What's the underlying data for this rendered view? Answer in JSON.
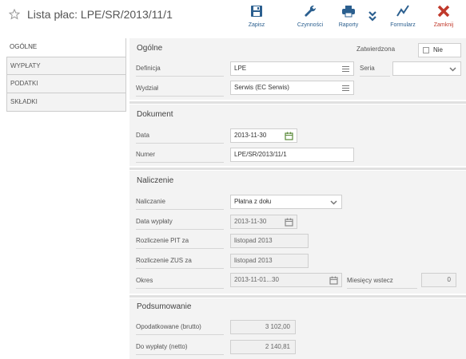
{
  "header": {
    "title": "Lista płac: LPE/SR/2013/11/1"
  },
  "toolbar": {
    "save": "Zapisz",
    "actions": "Czynności",
    "reports": "Raporty",
    "form": "Formularz",
    "close": "Zamknij"
  },
  "nav": {
    "items": [
      "OGÓLNE",
      "WYPŁATY",
      "PODATKI",
      "SKŁADKI"
    ]
  },
  "general": {
    "title": "Ogólne",
    "approved_label": "Zatwierdzona",
    "approved_value": "Nie",
    "definition_label": "Definicja",
    "definition_value": "LPE",
    "series_label": "Seria",
    "series_value": "",
    "department_label": "Wydział",
    "department_value": "Serwis (EC Serwis)"
  },
  "document": {
    "title": "Dokument",
    "date_label": "Data",
    "date_value": "2013-11-30",
    "number_label": "Numer",
    "number_value": "LPE/SR/2013/11/1"
  },
  "calc": {
    "title": "Naliczenie",
    "calc_label": "Naliczanie",
    "calc_value": "Płatna z dołu",
    "paydate_label": "Data wypłaty",
    "paydate_value": "2013-11-30",
    "pit_label": "Rozliczenie PIT za",
    "pit_value": "listopad 2013",
    "zus_label": "Rozliczenie ZUS za",
    "zus_value": "listopad 2013",
    "period_label": "Okres",
    "period_value": "2013-11-01...30",
    "months_back_label": "Miesięcy wstecz",
    "months_back_value": "0"
  },
  "summary": {
    "title": "Podsumowanie",
    "taxed_label": "Opodatkowane (brutto)",
    "taxed_value": "3 102,00",
    "payout_label": "Do wypłaty (netto)",
    "payout_value": "2 140,81"
  },
  "colors": {
    "toolbar_label": "#2b5f8f",
    "close_red": "#c0392b",
    "calendar_green": "#5a8a3a",
    "section_bg": "#f3f3f3"
  }
}
